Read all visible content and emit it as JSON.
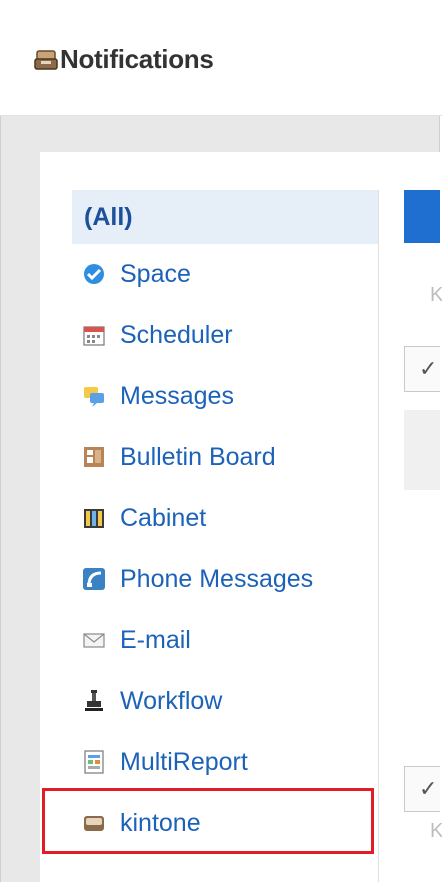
{
  "header": {
    "title": "Notifications",
    "icon": "notifications-tray-icon"
  },
  "sidebar": {
    "items": [
      {
        "label": "(All)",
        "icon": ""
      },
      {
        "label": "Space",
        "icon": "space-icon"
      },
      {
        "label": "Scheduler",
        "icon": "calendar-icon"
      },
      {
        "label": "Messages",
        "icon": "speech-bubble-icon"
      },
      {
        "label": "Bulletin Board",
        "icon": "bulletin-board-icon"
      },
      {
        "label": "Cabinet",
        "icon": "cabinet-icon"
      },
      {
        "label": "Phone Messages",
        "icon": "phone-icon"
      },
      {
        "label": "E-mail",
        "icon": "envelope-icon"
      },
      {
        "label": "Workflow",
        "icon": "stamp-icon"
      },
      {
        "label": "MultiReport",
        "icon": "report-icon"
      },
      {
        "label": "kintone",
        "icon": "kintone-tray-icon"
      }
    ]
  },
  "right": {
    "k_top": "K",
    "k_bottom": "K",
    "check": "✓"
  },
  "colors": {
    "accent": "#1f6fd1",
    "link": "#1c62b9",
    "highlight": "#e11c24",
    "selected_bg": "#e6eef8"
  }
}
